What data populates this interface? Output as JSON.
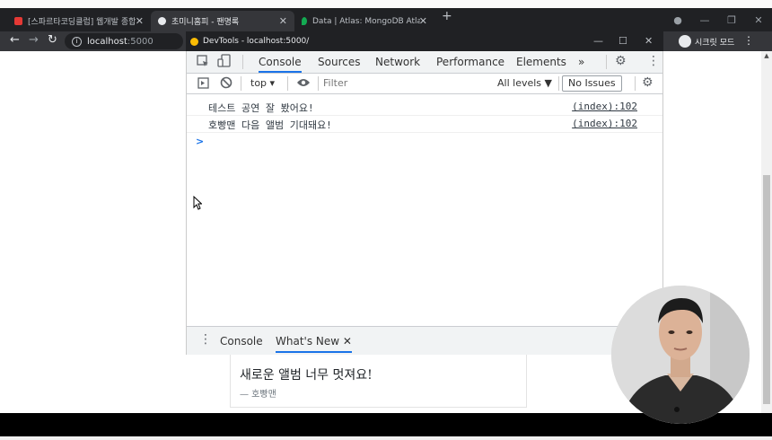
{
  "browser": {
    "tabs": [
      {
        "title": "[스파르타코딩클럽] 웹개발 종합",
        "icon": "notebook-icon",
        "icon_color": "#e53935"
      },
      {
        "title": "초미니홈피 - 팬명록",
        "icon": "globe-icon",
        "icon_color": "#e8eaed"
      },
      {
        "title": "Data | Atlas: MongoDB Atlas",
        "icon": "mongodb-leaf-icon",
        "icon_color": "#13aa52"
      }
    ],
    "new_tab": "+",
    "url_host": "localhost",
    "url_port": ":5000",
    "profile_label": "시크릿 모드"
  },
  "devtools": {
    "title": "DevTools - localhost:5000/",
    "tabs": [
      "Console",
      "Sources",
      "Network",
      "Performance",
      "Elements"
    ],
    "overflow": "»",
    "context": "top",
    "filter_placeholder": "Filter",
    "levels": "All levels ▼",
    "issues_button": "No Issues",
    "logs": [
      {
        "message": "테스트 공연 잘 봤어요!",
        "source": "(index):102"
      },
      {
        "message": "호빵맨 다음 앨범 기대돼요!",
        "source": "(index):102"
      }
    ],
    "prompt": ">",
    "drawer_tabs": [
      "Console",
      "What's New"
    ],
    "drawer_close": "✕"
  },
  "page": {
    "card_text": "새로운 앨범 너무 멋져요!",
    "card_author": "— 호빵맨"
  },
  "colors": {
    "accent": "#1a73e8",
    "chrome_dark": "#202124",
    "chrome_toolbar": "#35363a"
  }
}
